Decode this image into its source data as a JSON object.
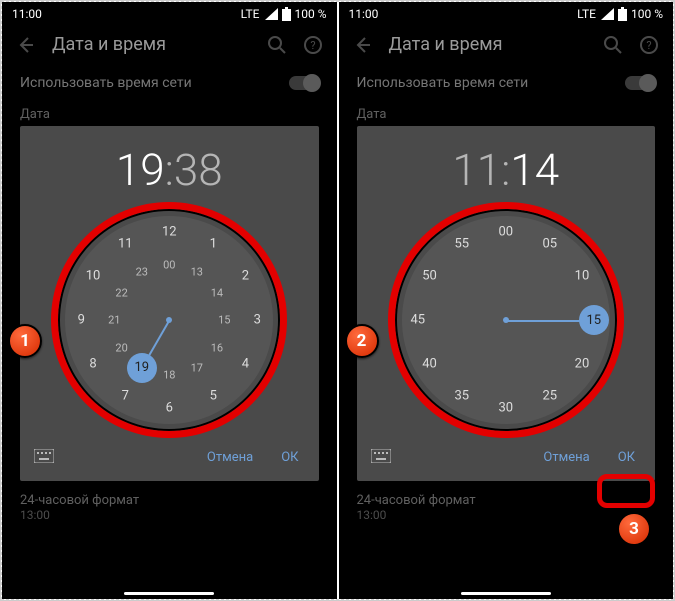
{
  "statusbar": {
    "time": "11:00",
    "net": "LTE",
    "battery": "100 %"
  },
  "appbar": {
    "title": "Дата и время"
  },
  "rows": {
    "use_net_time": "Использовать время сети",
    "date_label": "Дата",
    "format24": "24-часовой формат",
    "format_example": "13:00"
  },
  "dialog": {
    "cancel": "Отмена",
    "ok": "ОК"
  },
  "left": {
    "hour": "19",
    "colon": ":",
    "minute": "38",
    "selected_hour": "19",
    "outer": [
      "12",
      "1",
      "2",
      "3",
      "4",
      "5",
      "6",
      "7",
      "8",
      "9",
      "10",
      "11"
    ],
    "inner": [
      "00",
      "13",
      "14",
      "15",
      "16",
      "17",
      "18",
      "19",
      "20",
      "21",
      "22",
      "23"
    ]
  },
  "right": {
    "hour": "11",
    "colon": ":",
    "minute": "14",
    "selected_min": "15",
    "outer": [
      "00",
      "05",
      "10",
      "15",
      "20",
      "25",
      "30",
      "35",
      "40",
      "45",
      "50",
      "55"
    ]
  },
  "badges": {
    "b1": "1",
    "b2": "2",
    "b3": "3"
  }
}
